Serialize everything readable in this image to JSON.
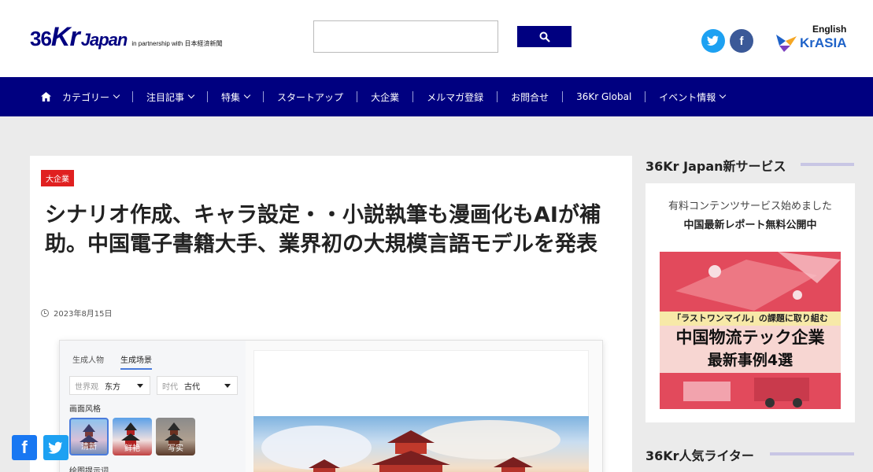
{
  "header": {
    "logo": {
      "mark_a": "36",
      "mark_b": "Kr",
      "mark_c": "Japan",
      "tagline": "in partnership with 日本経済新聞"
    },
    "search": {
      "placeholder": ""
    },
    "language_link": "English",
    "partner_logo": "KrASIA"
  },
  "nav": {
    "items": [
      {
        "label": "カテゴリー",
        "dropdown": true
      },
      {
        "label": "注目記事",
        "dropdown": true
      },
      {
        "label": "特集",
        "dropdown": true
      },
      {
        "label": "スタートアップ",
        "dropdown": false
      },
      {
        "label": "大企業",
        "dropdown": false
      },
      {
        "label": "メルマガ登録",
        "dropdown": false
      },
      {
        "label": "お問合せ",
        "dropdown": false
      },
      {
        "label": "36Kr Global",
        "dropdown": false
      },
      {
        "label": "イベント情報",
        "dropdown": true
      }
    ]
  },
  "article": {
    "category": "大企業",
    "title": "シナリオ作成、キャラ設定・・小説執筆も漫画化もAIが補助。中国電子書籍大手、業界初の大規模言語モデルを発表",
    "date": "2023年8月15日",
    "image": {
      "tab_1": "生成人物",
      "tab_2": "生成场景",
      "select_1_label": "世界观",
      "select_1_value": "东方",
      "select_2_label": "时代",
      "select_2_value": "古代",
      "style_label": "画面风格",
      "styles": [
        "清新",
        "鲜艳",
        "写实"
      ],
      "prompt_label": "绘图提示词"
    }
  },
  "sidebar": {
    "heading_1": "36Kr Japan新サービス",
    "promo_line_1": "有料コンテンツサービス始めました",
    "promo_line_2": "中国最新レポート無料公開中",
    "promo_image": {
      "band": "「ラストワンマイル」の課題に取り組む",
      "line_1": "中国物流テック企業",
      "line_2": "最新事例4選"
    },
    "heading_2": "36Kr人気ライター"
  },
  "colors": {
    "brand": "#000080",
    "category_badge": "#e02020",
    "twitter": "#1da1f2",
    "facebook": "#3b5998"
  }
}
